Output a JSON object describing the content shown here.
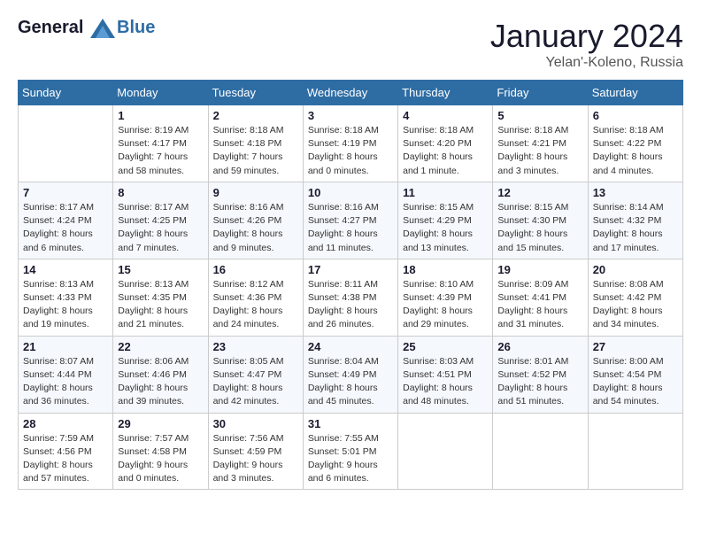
{
  "header": {
    "logo_line1": "General",
    "logo_line2": "Blue",
    "month": "January 2024",
    "location": "Yelan'-Koleno, Russia"
  },
  "weekdays": [
    "Sunday",
    "Monday",
    "Tuesday",
    "Wednesday",
    "Thursday",
    "Friday",
    "Saturday"
  ],
  "weeks": [
    [
      {
        "day": "",
        "info": ""
      },
      {
        "day": "1",
        "info": "Sunrise: 8:19 AM\nSunset: 4:17 PM\nDaylight: 7 hours\nand 58 minutes."
      },
      {
        "day": "2",
        "info": "Sunrise: 8:18 AM\nSunset: 4:18 PM\nDaylight: 7 hours\nand 59 minutes."
      },
      {
        "day": "3",
        "info": "Sunrise: 8:18 AM\nSunset: 4:19 PM\nDaylight: 8 hours\nand 0 minutes."
      },
      {
        "day": "4",
        "info": "Sunrise: 8:18 AM\nSunset: 4:20 PM\nDaylight: 8 hours\nand 1 minute."
      },
      {
        "day": "5",
        "info": "Sunrise: 8:18 AM\nSunset: 4:21 PM\nDaylight: 8 hours\nand 3 minutes."
      },
      {
        "day": "6",
        "info": "Sunrise: 8:18 AM\nSunset: 4:22 PM\nDaylight: 8 hours\nand 4 minutes."
      }
    ],
    [
      {
        "day": "7",
        "info": "Sunrise: 8:17 AM\nSunset: 4:24 PM\nDaylight: 8 hours\nand 6 minutes."
      },
      {
        "day": "8",
        "info": "Sunrise: 8:17 AM\nSunset: 4:25 PM\nDaylight: 8 hours\nand 7 minutes."
      },
      {
        "day": "9",
        "info": "Sunrise: 8:16 AM\nSunset: 4:26 PM\nDaylight: 8 hours\nand 9 minutes."
      },
      {
        "day": "10",
        "info": "Sunrise: 8:16 AM\nSunset: 4:27 PM\nDaylight: 8 hours\nand 11 minutes."
      },
      {
        "day": "11",
        "info": "Sunrise: 8:15 AM\nSunset: 4:29 PM\nDaylight: 8 hours\nand 13 minutes."
      },
      {
        "day": "12",
        "info": "Sunrise: 8:15 AM\nSunset: 4:30 PM\nDaylight: 8 hours\nand 15 minutes."
      },
      {
        "day": "13",
        "info": "Sunrise: 8:14 AM\nSunset: 4:32 PM\nDaylight: 8 hours\nand 17 minutes."
      }
    ],
    [
      {
        "day": "14",
        "info": "Sunrise: 8:13 AM\nSunset: 4:33 PM\nDaylight: 8 hours\nand 19 minutes."
      },
      {
        "day": "15",
        "info": "Sunrise: 8:13 AM\nSunset: 4:35 PM\nDaylight: 8 hours\nand 21 minutes."
      },
      {
        "day": "16",
        "info": "Sunrise: 8:12 AM\nSunset: 4:36 PM\nDaylight: 8 hours\nand 24 minutes."
      },
      {
        "day": "17",
        "info": "Sunrise: 8:11 AM\nSunset: 4:38 PM\nDaylight: 8 hours\nand 26 minutes."
      },
      {
        "day": "18",
        "info": "Sunrise: 8:10 AM\nSunset: 4:39 PM\nDaylight: 8 hours\nand 29 minutes."
      },
      {
        "day": "19",
        "info": "Sunrise: 8:09 AM\nSunset: 4:41 PM\nDaylight: 8 hours\nand 31 minutes."
      },
      {
        "day": "20",
        "info": "Sunrise: 8:08 AM\nSunset: 4:42 PM\nDaylight: 8 hours\nand 34 minutes."
      }
    ],
    [
      {
        "day": "21",
        "info": "Sunrise: 8:07 AM\nSunset: 4:44 PM\nDaylight: 8 hours\nand 36 minutes."
      },
      {
        "day": "22",
        "info": "Sunrise: 8:06 AM\nSunset: 4:46 PM\nDaylight: 8 hours\nand 39 minutes."
      },
      {
        "day": "23",
        "info": "Sunrise: 8:05 AM\nSunset: 4:47 PM\nDaylight: 8 hours\nand 42 minutes."
      },
      {
        "day": "24",
        "info": "Sunrise: 8:04 AM\nSunset: 4:49 PM\nDaylight: 8 hours\nand 45 minutes."
      },
      {
        "day": "25",
        "info": "Sunrise: 8:03 AM\nSunset: 4:51 PM\nDaylight: 8 hours\nand 48 minutes."
      },
      {
        "day": "26",
        "info": "Sunrise: 8:01 AM\nSunset: 4:52 PM\nDaylight: 8 hours\nand 51 minutes."
      },
      {
        "day": "27",
        "info": "Sunrise: 8:00 AM\nSunset: 4:54 PM\nDaylight: 8 hours\nand 54 minutes."
      }
    ],
    [
      {
        "day": "28",
        "info": "Sunrise: 7:59 AM\nSunset: 4:56 PM\nDaylight: 8 hours\nand 57 minutes."
      },
      {
        "day": "29",
        "info": "Sunrise: 7:57 AM\nSunset: 4:58 PM\nDaylight: 9 hours\nand 0 minutes."
      },
      {
        "day": "30",
        "info": "Sunrise: 7:56 AM\nSunset: 4:59 PM\nDaylight: 9 hours\nand 3 minutes."
      },
      {
        "day": "31",
        "info": "Sunrise: 7:55 AM\nSunset: 5:01 PM\nDaylight: 9 hours\nand 6 minutes."
      },
      {
        "day": "",
        "info": ""
      },
      {
        "day": "",
        "info": ""
      },
      {
        "day": "",
        "info": ""
      }
    ]
  ]
}
